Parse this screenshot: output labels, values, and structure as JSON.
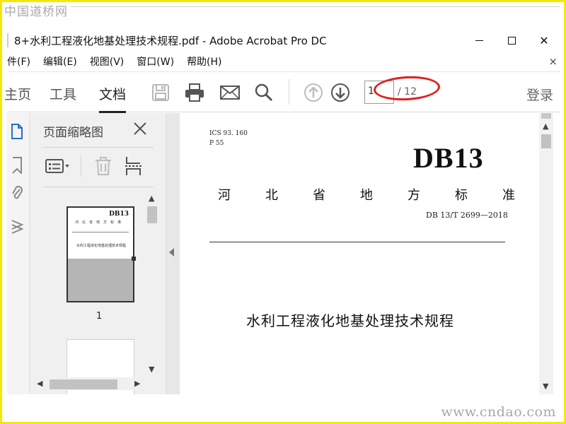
{
  "watermarks": {
    "top": "中国道桥网",
    "bottom": "www.cndao.com"
  },
  "window": {
    "title": "8+水利工程液化地基处理技术规程.pdf - Adobe Acrobat Pro DC",
    "minimize_icon": "minimize-icon",
    "maximize_icon": "maximize-icon",
    "close_glyph": "✕"
  },
  "menu": {
    "items": [
      "件(F)",
      "编辑(E)",
      "视图(V)",
      "窗口(W)",
      "帮助(H)"
    ],
    "close_glyph": "×"
  },
  "toolbar": {
    "tabs": [
      "主页",
      "工具",
      "文档"
    ],
    "active_tab": "文档",
    "icons": [
      "save-icon",
      "print-icon",
      "email-icon",
      "search-icon",
      "page-up-icon",
      "page-down-icon"
    ],
    "page_current": "1",
    "page_total": "/ 12",
    "login": "登录"
  },
  "left_rail": {
    "icons": [
      "page-thumbnails-icon",
      "bookmark-icon",
      "attachment-icon",
      "layers-icon"
    ]
  },
  "thumbnail_panel": {
    "title": "页面缩略图",
    "tools": [
      "options-menu-icon",
      "delete-icon",
      "extract-icon"
    ],
    "pages": [
      {
        "label": "1",
        "db_text": "DB13",
        "province_text": "河北省地方标准",
        "title_text": "水利工程液化地基处理技术规程"
      }
    ]
  },
  "document": {
    "ics": "ICS  93. 160",
    "p": "P  55",
    "db_code": "DB13",
    "province_chars": [
      "河",
      "北",
      "省",
      "地",
      "方",
      "标",
      "准"
    ],
    "standard_number": "DB 13/T  2699—2018",
    "title": "水利工程液化地基处理技术规程"
  },
  "colors": {
    "frame": "#f2e90a",
    "annotation_ellipse": "#e02020"
  }
}
